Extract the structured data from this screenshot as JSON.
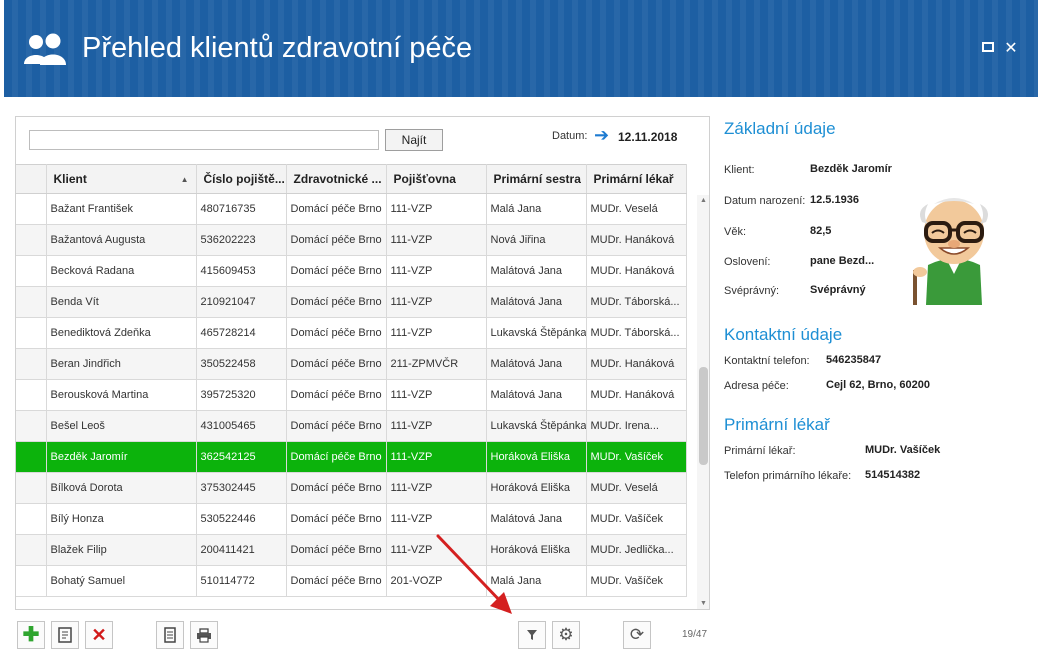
{
  "window": {
    "title": "Přehled klientů zdravotní péče",
    "title_icon": "users-icon",
    "controls": [
      "maximize-icon",
      "close-icon"
    ]
  },
  "search": {
    "value": "",
    "placeholder": "",
    "button_label": "Najít"
  },
  "date": {
    "label": "Datum:",
    "icon": "arrow-right-icon",
    "value": "12.11.2018"
  },
  "grid": {
    "columns": [
      "Klient",
      "Číslo pojiště...",
      "Zdravotnické ...",
      "Pojišťovna",
      "Primární sestra",
      "Primární lékař"
    ],
    "sorted_column": "Klient",
    "sort_direction": "ascending",
    "rows": [
      [
        "Bažant František",
        "480716735",
        "Domácí péče Brno",
        "111-VZP",
        "Malá Jana",
        "MUDr. Veselá"
      ],
      [
        "Bažantová Augusta",
        "536202223",
        "Domácí péče Brno",
        "111-VZP",
        "Nová Jiřina",
        "MUDr. Hanáková"
      ],
      [
        "Becková Radana",
        "415609453",
        "Domácí péče Brno",
        "111-VZP",
        "Malátová Jana",
        "MUDr. Hanáková"
      ],
      [
        "Benda Vít",
        "210921047",
        "Domácí péče Brno",
        "111-VZP",
        "Malátová Jana",
        "MUDr. Táborská..."
      ],
      [
        "Benediktová Zdeňka",
        "465728214",
        "Domácí péče Brno",
        "111-VZP",
        "Lukavská Štěpánka",
        "MUDr. Táborská..."
      ],
      [
        "Beran Jindřich",
        "350522458",
        "Domácí péče Brno",
        "211-ZPMVČR",
        "Malátová Jana",
        "MUDr. Hanáková"
      ],
      [
        "Berousková Martina",
        "395725320",
        "Domácí péče Brno",
        "111-VZP",
        "Malátová Jana",
        "MUDr. Hanáková"
      ],
      [
        "Bešel Leoš",
        "431005465",
        "Domácí péče Brno",
        "111-VZP",
        "Lukavská Štěpánka",
        "MUDr. Irena..."
      ],
      [
        "Bezděk Jaromír",
        "362542125",
        "Domácí péče Brno",
        "111-VZP",
        "Horáková Eliška",
        "MUDr. Vašíček"
      ],
      [
        "Bílková Dorota",
        "375302445",
        "Domácí péče Brno",
        "111-VZP",
        "Horáková Eliška",
        "MUDr. Veselá"
      ],
      [
        "Bílý Honza",
        "530522446",
        "Domácí péče Brno",
        "111-VZP",
        "Malátová Jana",
        "MUDr. Vašíček"
      ],
      [
        "Blažek Filip",
        "200411421",
        "Domácí péče Brno",
        "111-VZP",
        "Horáková Eliška",
        "MUDr. Jedlička..."
      ],
      [
        "Bohatý Samuel",
        "510114772",
        "Domácí péče Brno",
        "201-VOZP",
        "Malá Jana",
        "MUDr. Vašíček"
      ]
    ],
    "selected_row_index": 8,
    "selected_color": "#0cb30c"
  },
  "toolbar": {
    "buttons": [
      "add-icon",
      "edit-icon",
      "delete-icon",
      "document-icon",
      "print-icon",
      "filter-icon",
      "settings-icon",
      "refresh-icon"
    ],
    "count_text": "19/47"
  },
  "details": {
    "basic": {
      "title": "Základní údaje",
      "client_label": "Klient:",
      "client_value": "Bezděk Jaromír",
      "birth_label": "Datum narození:",
      "birth_value": "12.5.1936",
      "age_label": "Věk:",
      "age_value": "82,5",
      "salutation_label": "Oslovení:",
      "salutation_value": "pane Bezd...",
      "competent_label": "Svéprávný:",
      "competent_value": "Svéprávný"
    },
    "contact": {
      "title": "Kontaktní údaje",
      "phone_label": "Kontaktní telefon:",
      "phone_value": "546235847",
      "address_label": "Adresa péče:",
      "address_value": "Cejl 62, Brno, 60200"
    },
    "doctor": {
      "title": "Primární lékař",
      "doctor_label": "Primární lékař:",
      "doctor_value": "MUDr. Vašíček",
      "phone_label": "Telefon primárního lékaře:",
      "phone_value": "514514382"
    }
  },
  "colors": {
    "header": "#1d5fa3",
    "section_title": "#1e8fd4",
    "selected_row": "#0cb30c",
    "annotation_arrow": "#d42020"
  }
}
